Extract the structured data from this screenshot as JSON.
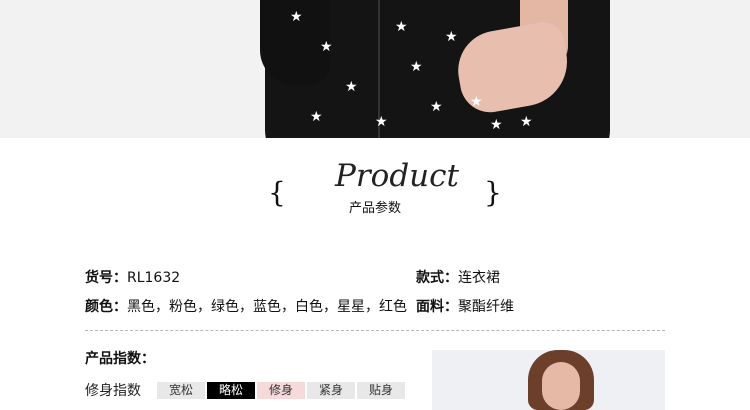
{
  "product_section": {
    "title_script": "Product",
    "title_cn": "产品参数",
    "left_brace": "{",
    "right_brace": "}"
  },
  "specs": {
    "item_no_label": "货号：",
    "item_no_value": "RL1632",
    "style_label": "款式：",
    "style_value": "连衣裙",
    "color_label": "颜色：",
    "color_value": "黑色，粉色，绿色，蓝色，白色，星星，红色",
    "fabric_label": "面料：",
    "fabric_value": "聚酯纤维"
  },
  "indices": {
    "section_label": "产品指数：",
    "fit_label": "修身指数",
    "fit_options": [
      "宽松",
      "略松",
      "修身",
      "紧身",
      "贴身"
    ],
    "fit_selected": "略松"
  },
  "colors": {
    "active_bg": "#000000",
    "pink_bg": "#f6dada",
    "inactive_bg": "#e8e8e8"
  }
}
